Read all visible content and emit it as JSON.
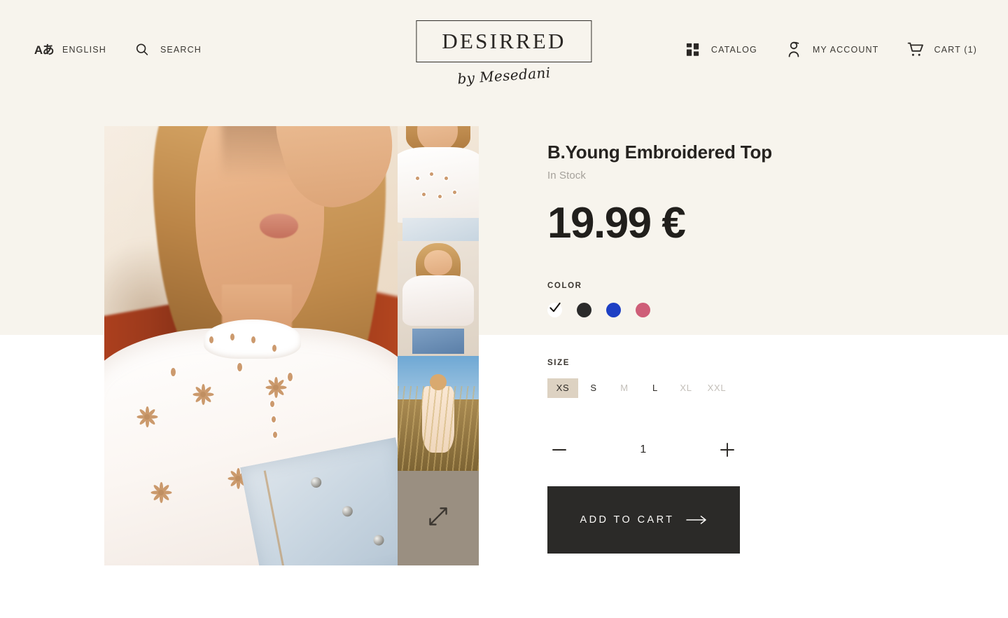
{
  "header": {
    "language": {
      "label": "ENGLISH",
      "icon": "language-icon",
      "glyph": "Aあ"
    },
    "search": {
      "label": "SEARCH",
      "icon": "search-icon"
    },
    "logo": {
      "name": "DESIRRED",
      "byline": "by Mesedani"
    },
    "catalog": {
      "label": "CATALOG",
      "icon": "grid-icon"
    },
    "account": {
      "label": "MY ACCOUNT",
      "icon": "user-icon"
    },
    "cart": {
      "label": "CART (1)",
      "icon": "cart-icon",
      "count": 1
    }
  },
  "gallery": {
    "main_alt": "Woman in white eyelet embroidered top shielding eyes from sun",
    "thumbnails": [
      {
        "alt": "White embroidered top with denim shorts"
      },
      {
        "alt": "Off-shoulder white blouse with denim shorts"
      },
      {
        "alt": "Beige slip dress in a field"
      }
    ],
    "expand": {
      "icon": "expand-icon",
      "label": "Expand image"
    }
  },
  "product": {
    "title": "B.Young Embroidered Top",
    "stock": "In Stock",
    "price": "19.99 €",
    "color": {
      "label": "COLOR",
      "options": [
        {
          "name": "white",
          "hex": "#ffffff",
          "selected": true
        },
        {
          "name": "black",
          "hex": "#2b2b2b",
          "selected": false
        },
        {
          "name": "blue",
          "hex": "#1d3fc4",
          "selected": false
        },
        {
          "name": "pink",
          "hex": "#ce5e78",
          "selected": false
        }
      ]
    },
    "size": {
      "label": "SIZE",
      "options": [
        {
          "label": "XS",
          "selected": true,
          "available": true
        },
        {
          "label": "S",
          "selected": false,
          "available": true
        },
        {
          "label": "M",
          "selected": false,
          "available": false
        },
        {
          "label": "L",
          "selected": false,
          "available": true
        },
        {
          "label": "XL",
          "selected": false,
          "available": false
        },
        {
          "label": "XXL",
          "selected": false,
          "available": false
        }
      ]
    },
    "quantity": {
      "value": "1",
      "decrease": "−",
      "increase": "+"
    },
    "add_to_cart": {
      "label": "ADD TO CART",
      "icon": "arrow-right-icon"
    }
  },
  "theme": {
    "cream": "#f7f4ed",
    "white": "#ffffff",
    "ink": "#2b2a28",
    "muted": "#a5a19b",
    "size_selected_bg": "#ddd2c2",
    "expand_tile": "#9a8f81"
  }
}
